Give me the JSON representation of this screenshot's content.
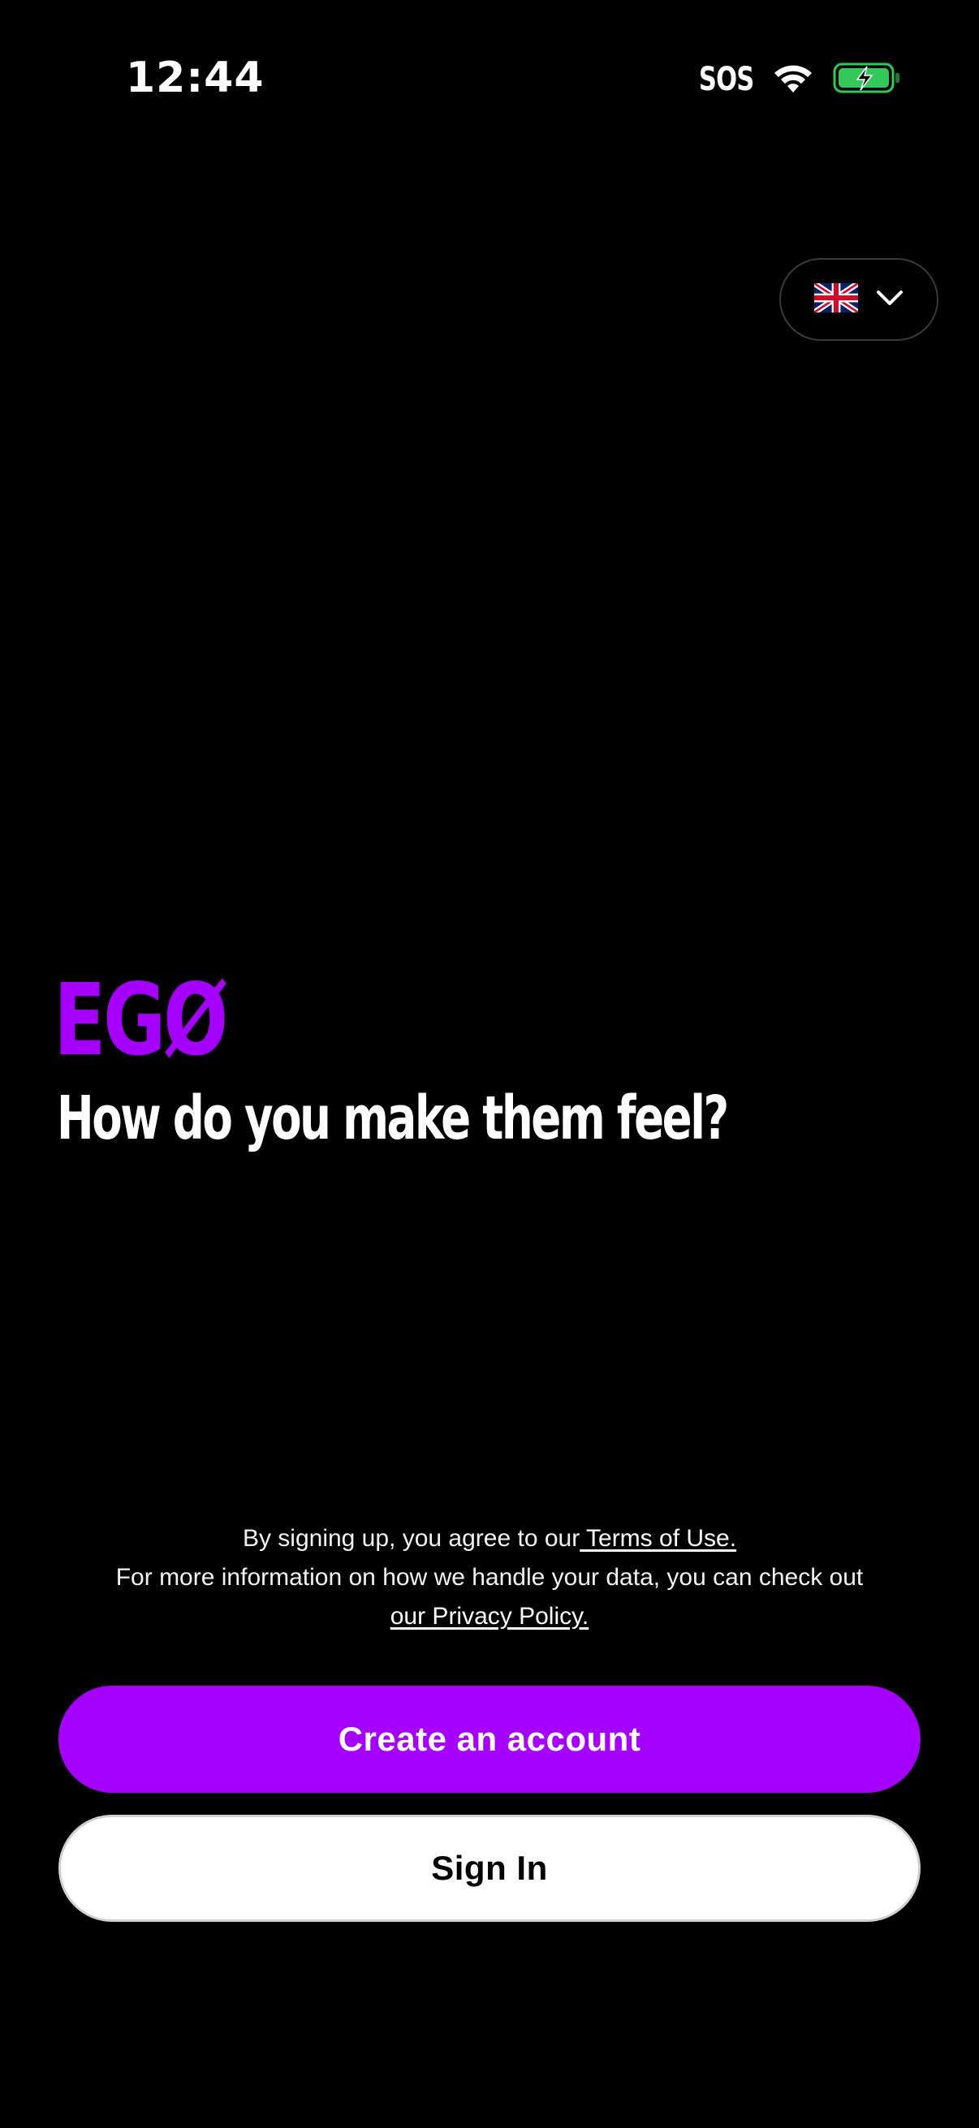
{
  "status_bar": {
    "time": "12:44",
    "carrier": "SOS",
    "icons": [
      "wifi-icon",
      "battery-charging-icon"
    ]
  },
  "language_selector": {
    "flag_icon": "uk-flag-icon",
    "chevron_icon": "chevron-down-icon"
  },
  "brand": {
    "logo_text": "EGØ",
    "tagline": "How do you make them feel?"
  },
  "legal": {
    "line1_prefix": "By signing up, you agree to our",
    "terms_link": " Terms of Use.",
    "line2": "For more information on how we handle your data, you can check out",
    "privacy_link": "our Privacy Policy."
  },
  "actions": {
    "create_account": "Create an account",
    "sign_in": "Sign In"
  },
  "colors": {
    "background": "#000000",
    "brand_purple": "#A500FF",
    "battery_green": "#34C759"
  }
}
